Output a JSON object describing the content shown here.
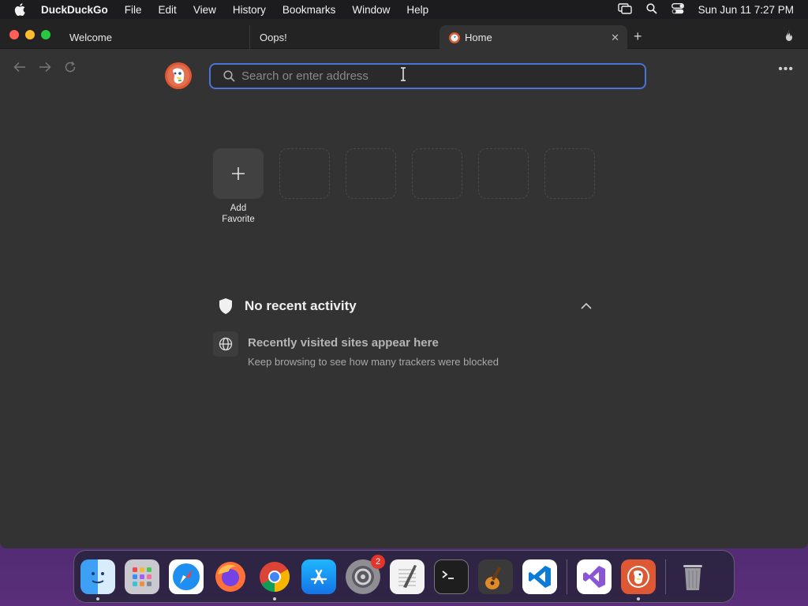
{
  "menubar": {
    "apple_icon": "apple-logo",
    "app_name": "DuckDuckGo",
    "items": [
      "File",
      "Edit",
      "View",
      "History",
      "Bookmarks",
      "Window",
      "Help"
    ],
    "clock": "Sun Jun 11  7:27 PM"
  },
  "tabs": [
    {
      "label": "Welcome",
      "active": false
    },
    {
      "label": "Oops!",
      "active": false
    },
    {
      "label": "Home",
      "active": true
    }
  ],
  "address_bar": {
    "placeholder": "Search or enter address",
    "value": ""
  },
  "favorites": {
    "add_label": "Add Favorite",
    "empty_slots": 5
  },
  "recent_activity": {
    "title": "No recent activity",
    "heading": "Recently visited sites appear here",
    "subtext": "Keep browsing to see how many trackers were blocked"
  },
  "dock": {
    "apps": [
      "Finder",
      "Launchpad",
      "Safari",
      "Firefox",
      "Chrome",
      "App Store",
      "System Settings",
      "TextEdit",
      "Terminal",
      "GarageBand",
      "Visual Studio Code",
      "Visual Studio",
      "DuckDuckGo",
      "Trash"
    ],
    "system_settings_badge": "2"
  },
  "colors": {
    "window_bg": "#333333",
    "address_border": "#4a74d8",
    "accent_red": "#de5833"
  }
}
